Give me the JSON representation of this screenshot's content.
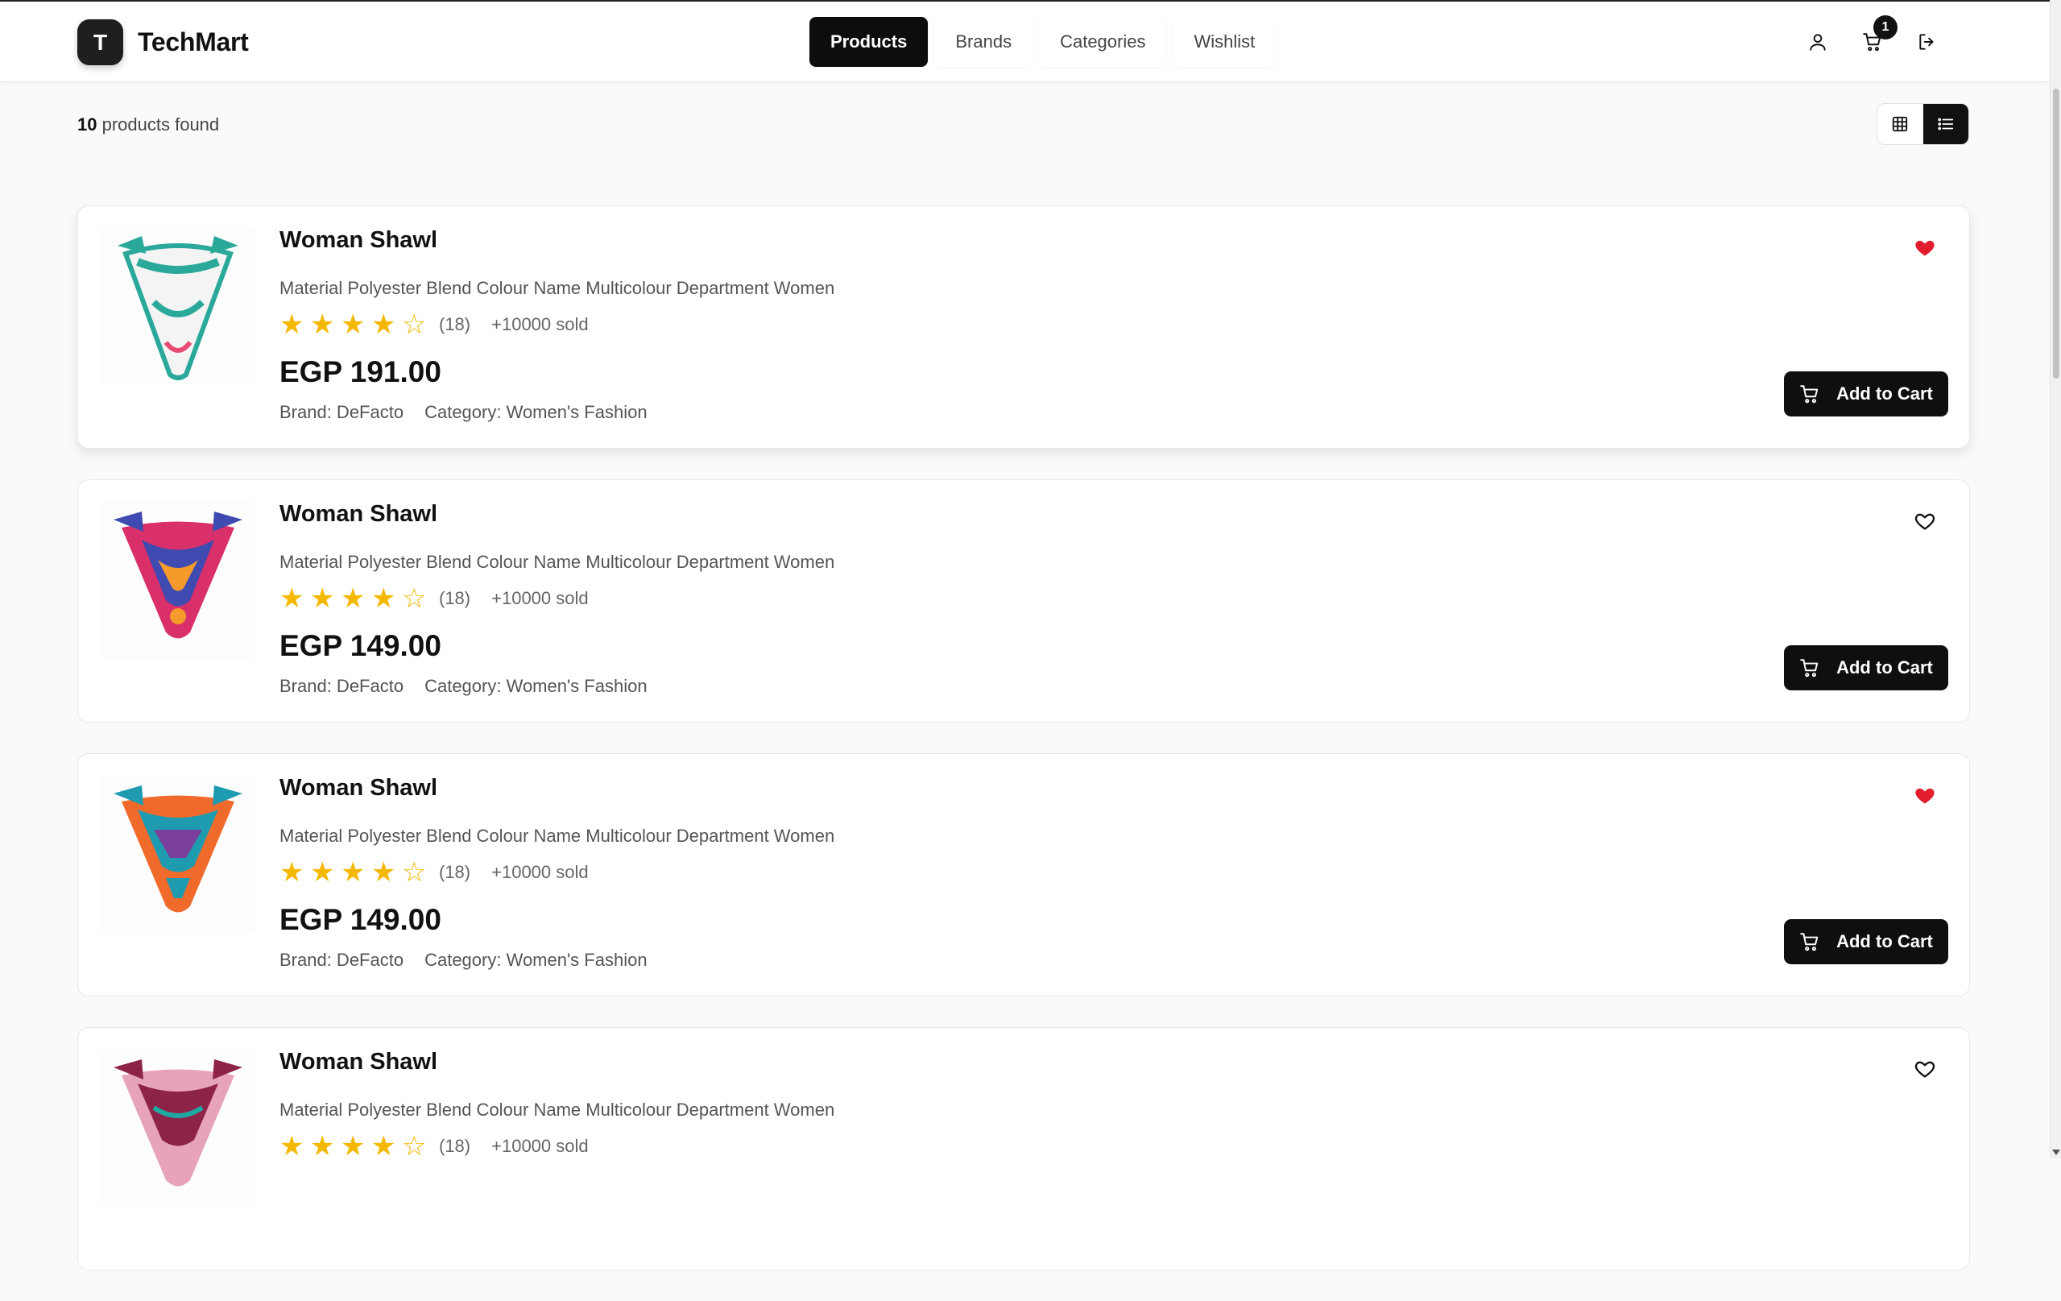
{
  "header": {
    "logo_letter": "T",
    "brand": "TechMart",
    "nav": [
      {
        "label": "Products",
        "active": true
      },
      {
        "label": "Brands",
        "active": false
      },
      {
        "label": "Categories",
        "active": false
      },
      {
        "label": "Wishlist",
        "active": false
      }
    ],
    "cart_count": "1"
  },
  "toolbar": {
    "count": "10",
    "count_suffix": "products found",
    "view_mode": "list"
  },
  "products": [
    {
      "title": "Woman Shawl",
      "description": "Material Polyester Blend Colour Name Multicolour Department Women",
      "rating_count": "(18)",
      "sold": "+10000 sold",
      "price": "EGP 191.00",
      "brand": "Brand: DeFacto",
      "category": "Category: Women's Fashion",
      "wishlisted": true,
      "cart_label": "Add to Cart",
      "image_palette": [
        "#2aa89a",
        "#e84a72",
        "#f3f3f3"
      ]
    },
    {
      "title": "Woman Shawl",
      "description": "Material Polyester Blend Colour Name Multicolour Department Women",
      "rating_count": "(18)",
      "sold": "+10000 sold",
      "price": "EGP 149.00",
      "brand": "Brand: DeFacto",
      "category": "Category: Women's Fashion",
      "wishlisted": false,
      "cart_label": "Add to Cart",
      "image_palette": [
        "#d92f6b",
        "#3f4bb0",
        "#f59a2b"
      ]
    },
    {
      "title": "Woman Shawl",
      "description": "Material Polyester Blend Colour Name Multicolour Department Women",
      "rating_count": "(18)",
      "sold": "+10000 sold",
      "price": "EGP 149.00",
      "brand": "Brand: DeFacto",
      "category": "Category: Women's Fashion",
      "wishlisted": true,
      "cart_label": "Add to Cart",
      "image_palette": [
        "#f06a2c",
        "#1f9bb0",
        "#7a3f9a"
      ]
    },
    {
      "title": "Woman Shawl",
      "description": "Material Polyester Blend Colour Name Multicolour Department Women",
      "rating_count": "(18)",
      "sold": "+10000 sold",
      "price": "",
      "brand": "",
      "category": "",
      "wishlisted": false,
      "cart_label": "",
      "image_palette": [
        "#8e2348",
        "#e7a3b8",
        "#1fa7a2"
      ]
    }
  ],
  "rating_stars": 4.5,
  "colors": {
    "accent": "#0f0f0f",
    "star": "#f5b800",
    "heart_active": "#e11d2e"
  }
}
